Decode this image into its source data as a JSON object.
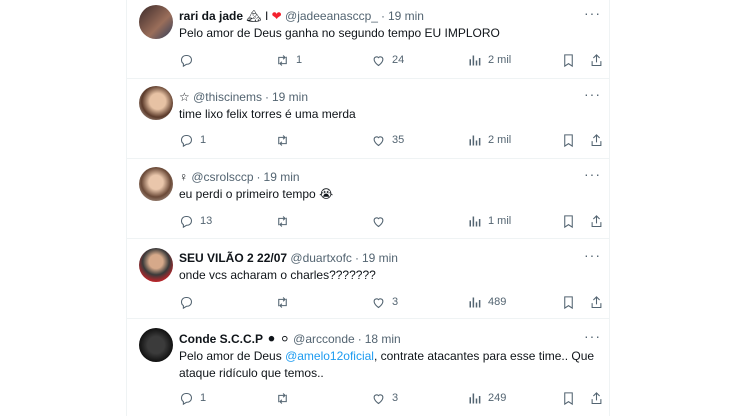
{
  "tweets": [
    {
      "name": "rari da jade",
      "name_suffix": "🏔 I",
      "heart": "❤",
      "handle": "@jadeeanasccp_",
      "time": "19 min",
      "text": "Pelo amor de Deus ganha no segundo tempo EU IMPLORO",
      "retweets": "1",
      "likes": "24",
      "views": "2 mil"
    },
    {
      "prefix": "☆",
      "handle": "@thiscinems",
      "time": "19 min",
      "text": "time lixo felix torres é uma merda",
      "replies": "1",
      "likes": "35",
      "views": "2 mil"
    },
    {
      "prefix": "♀",
      "handle": "@csrolsccp",
      "time": "19 min",
      "text": "eu perdi o primeiro tempo 😭",
      "replies": "13",
      "views": "1 mil"
    },
    {
      "name": "SEU VILÃO 2 22/07",
      "handle": "@duartxofc",
      "time": "19 min",
      "text": "onde vcs acharam o charles???????",
      "likes": "3",
      "views": "489"
    },
    {
      "name": "Conde S.C.C.P",
      "name_suffix": "⚫ ⚪",
      "handle": "@arcconde",
      "time": "18 min",
      "text_before": "Pelo amor de Deus ",
      "mention": "@amelo12oficial",
      "text_after": ", contrate atacantes para esse time.. Que ataque ridículo que temos..",
      "replies": "1",
      "likes": "3",
      "views": "249"
    }
  ],
  "more_label": "···",
  "colors": {
    "muted": "#536471",
    "link": "#1d9bf0",
    "heart": "#f4212e",
    "divider": "#eff3f4"
  }
}
